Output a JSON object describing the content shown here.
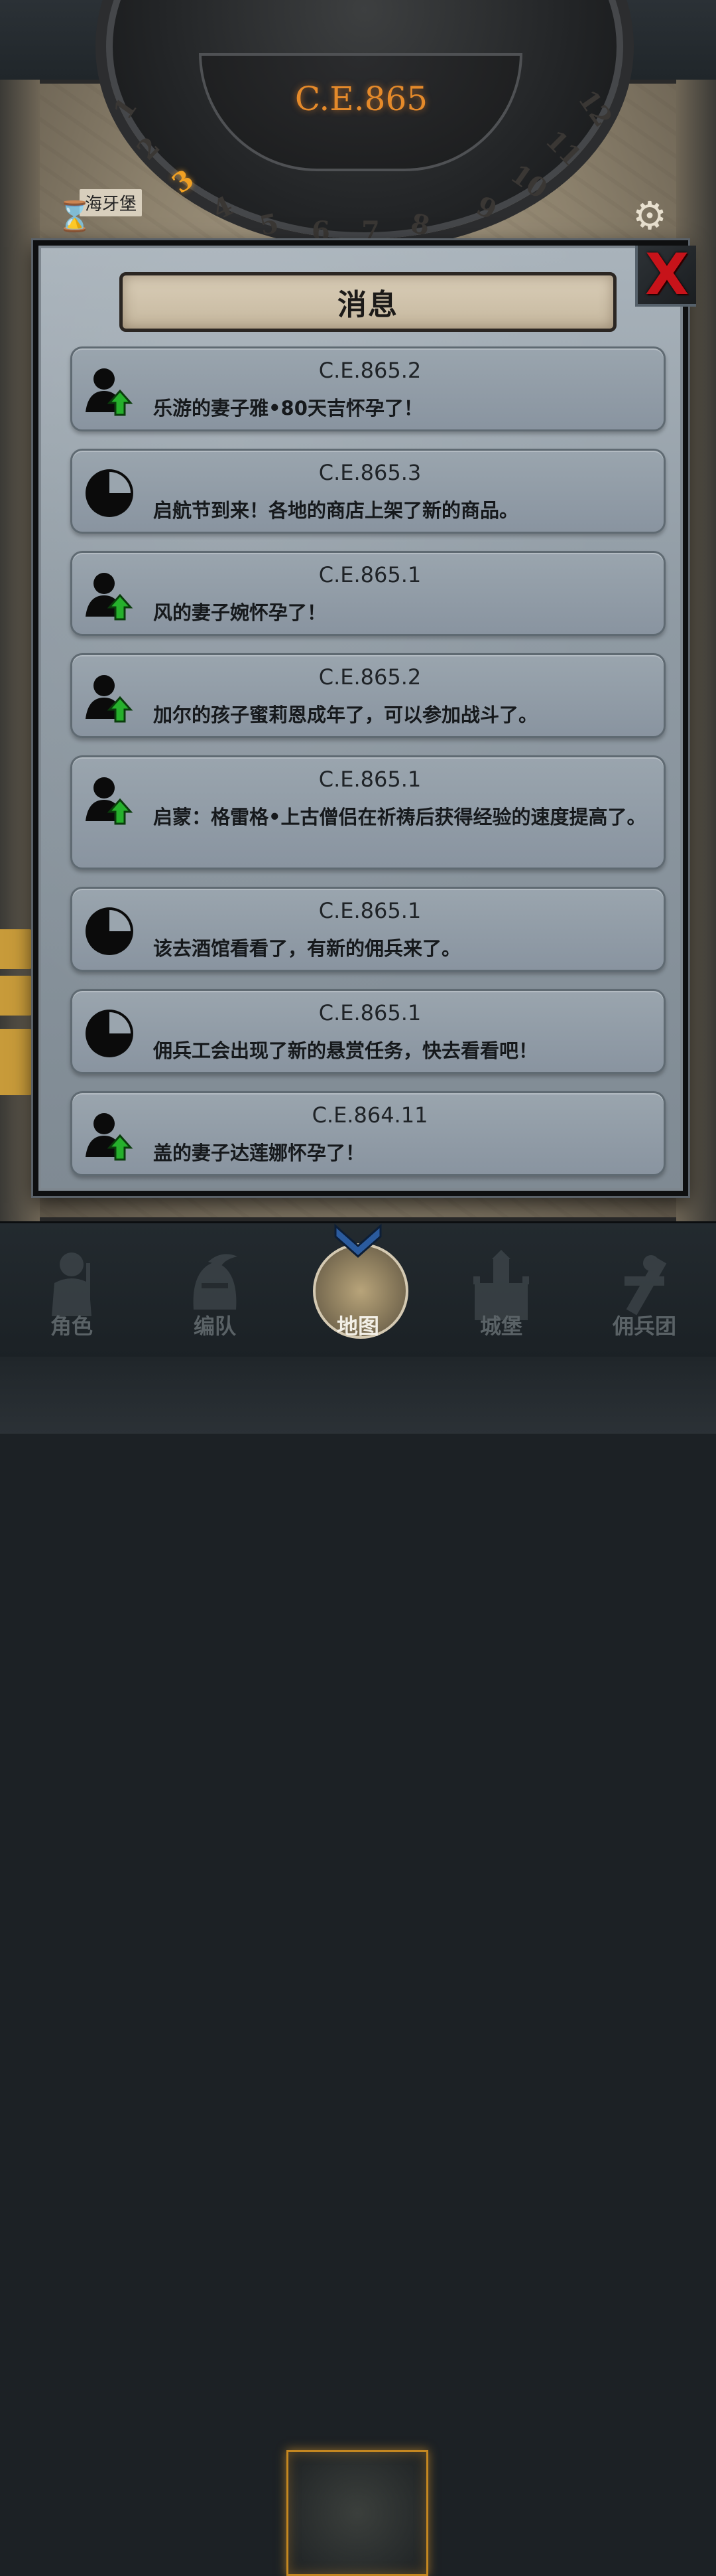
{
  "map": {
    "year": "C.E.865",
    "month_numbers": [
      "1",
      "2",
      "3",
      "4",
      "5",
      "6",
      "7",
      "8",
      "9",
      "10",
      "11",
      "12"
    ],
    "active_month": "3",
    "castle_label": "海牙堡"
  },
  "dialog": {
    "title": "消息",
    "close_symbol": "X",
    "messages": [
      {
        "date": "C.E.865.2",
        "text": "乐游的妻子雅•80天吉怀孕了！",
        "icon": "person-up-icon"
      },
      {
        "date": "C.E.865.3",
        "text": "启航节到来！各地的商店上架了新的商品。",
        "icon": "clock-pie-icon"
      },
      {
        "date": "C.E.865.1",
        "text": "风的妻子婉怀孕了！",
        "icon": "person-up-icon"
      },
      {
        "date": "C.E.865.2",
        "text": "加尔的孩子蜜莉恩成年了，可以参加战斗了。",
        "icon": "person-up-icon"
      },
      {
        "date": "C.E.865.1",
        "text": "启蒙：格雷格•上古僧侣在祈祷后获得经验的速度提高了。",
        "icon": "person-up-icon"
      },
      {
        "date": "C.E.865.1",
        "text": "该去酒馆看看了，有新的佣兵来了。",
        "icon": "clock-pie-icon"
      },
      {
        "date": "C.E.865.1",
        "text": "佣兵工会出现了新的悬赏任务，快去看看吧！",
        "icon": "clock-pie-icon"
      },
      {
        "date": "C.E.864.11",
        "text": "盖的妻子达莲娜怀孕了！",
        "icon": "person-up-icon"
      }
    ]
  },
  "nav": {
    "items": [
      {
        "label": "角色",
        "icon": "knight-icon"
      },
      {
        "label": "编队",
        "icon": "helmet-icon"
      },
      {
        "label": "地图",
        "icon": "compass-map-icon"
      },
      {
        "label": "城堡",
        "icon": "castle-icon"
      },
      {
        "label": "佣兵团",
        "icon": "mercenary-icon"
      }
    ],
    "active": "地图"
  },
  "colors": {
    "year_accent": "#e58a2a",
    "close_red": "#c7131a",
    "arrow_green": "#26b02c",
    "active_nav_frame": "#c48721"
  }
}
